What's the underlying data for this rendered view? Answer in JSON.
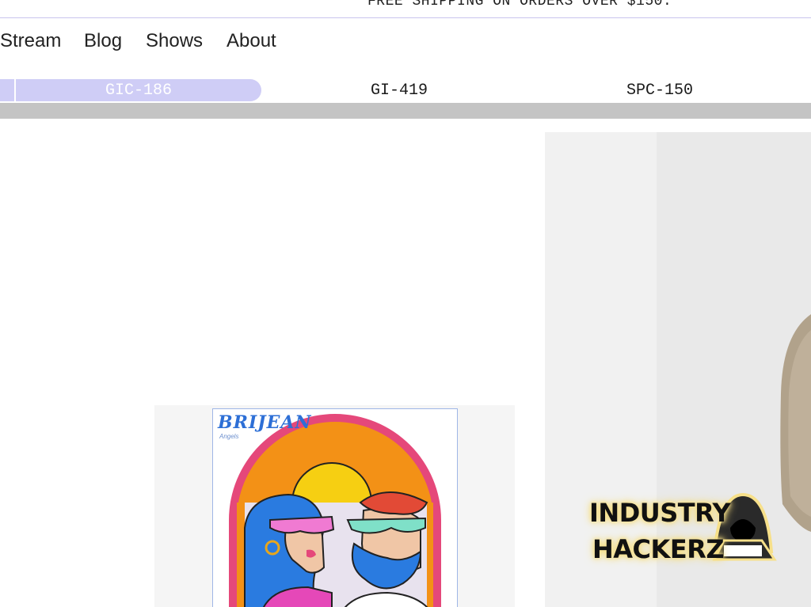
{
  "announcement": {
    "text": "FREE SHIPPING ON ORDERS OVER $150."
  },
  "nav": {
    "items": [
      {
        "label": "Stream"
      },
      {
        "label": "Blog"
      },
      {
        "label": "Shows"
      },
      {
        "label": "About"
      }
    ]
  },
  "tabs": {
    "active": "GIC-186",
    "items": [
      {
        "label": "GIC-186"
      },
      {
        "label": "GI-419"
      },
      {
        "label": "SPC-150"
      }
    ]
  },
  "products": {
    "left": {
      "brand": "BRIJEAN",
      "sub": "Angels"
    },
    "right": {
      "logo_line1": "INDUSTRY",
      "logo_line2": "HACKERZ"
    }
  },
  "colors": {
    "accent": "#cfcdf6",
    "divider": "#c9c4ee",
    "scrollbar": "#c4c4c4"
  }
}
